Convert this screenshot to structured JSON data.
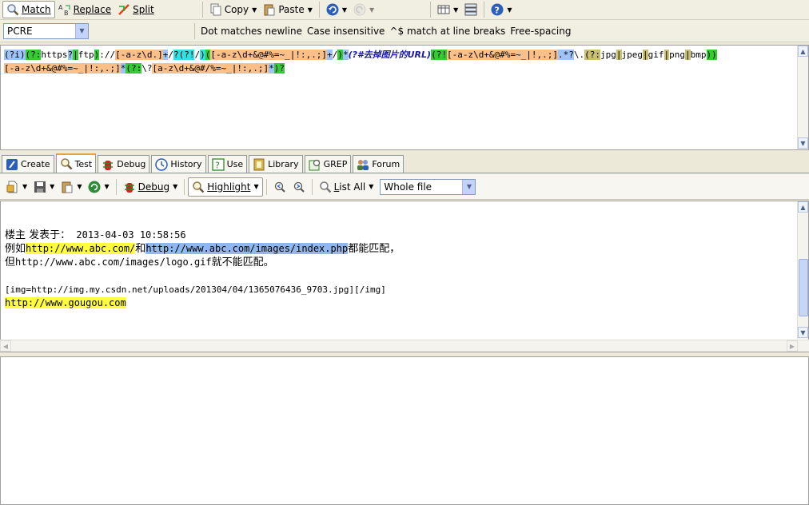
{
  "toolbar1": {
    "match": "Match",
    "replace": "Replace",
    "split": "Split",
    "copy": "Copy",
    "paste": "Paste"
  },
  "toolbar2": {
    "flavor": "PCRE",
    "options": [
      "Dot matches newline",
      "Case insensitive",
      "^$ match at line breaks",
      "Free-spacing"
    ]
  },
  "regex": {
    "tokens": [
      {
        "t": "(?i)",
        "c": "#9ec3f7"
      },
      {
        "t": "(?:",
        "c": "#33cc33"
      },
      {
        "t": "https",
        "c": ""
      },
      {
        "t": "?",
        "c": "#9ec3f7"
      },
      {
        "t": "|",
        "c": "#33cc33"
      },
      {
        "t": "ftp",
        "c": ""
      },
      {
        "t": ")",
        "c": "#33cc33"
      },
      {
        "t": "://",
        "c": ""
      },
      {
        "t": "[-a-z\\d.]",
        "c": "#fbc08a"
      },
      {
        "t": "+",
        "c": "#9ec3f7"
      },
      {
        "t": "/",
        "c": ""
      },
      {
        "t": "?(?!",
        "c": "#33e0e0"
      },
      {
        "t": "/",
        "c": ""
      },
      {
        "t": ")",
        "c": "#33e0e0"
      },
      {
        "t": "(",
        "c": "#33cc33"
      },
      {
        "t": "[-a-z\\d+&@#%=~_|!:,.;]",
        "c": "#fbc08a"
      },
      {
        "t": "+",
        "c": "#9ec3f7"
      },
      {
        "t": "/",
        "c": ""
      },
      {
        "t": ")",
        "c": "#33cc33"
      },
      {
        "t": "*",
        "c": "#9ec3f7"
      },
      {
        "t": "(?#去掉图片的URL)",
        "c": "cmt"
      },
      {
        "t": "(?!",
        "c": "#33cc33"
      },
      {
        "t": "[-a-z\\d+&@#%=~_|!,.;]",
        "c": "#fbc08a"
      },
      {
        "t": ".*?",
        "c": "#9ec3f7"
      },
      {
        "t": "\\.",
        "c": ""
      },
      {
        "t": "(?:",
        "c": "#c8c070"
      },
      {
        "t": "jpg",
        "c": ""
      },
      {
        "t": "|",
        "c": "#c8c070"
      },
      {
        "t": "jpeg",
        "c": ""
      },
      {
        "t": "|",
        "c": "#c8c070"
      },
      {
        "t": "gif",
        "c": ""
      },
      {
        "t": "|",
        "c": "#c8c070"
      },
      {
        "t": "png",
        "c": ""
      },
      {
        "t": "|",
        "c": "#c8c070"
      },
      {
        "t": "bmp",
        "c": ""
      },
      {
        "t": "))",
        "c": "#33cc33"
      },
      {
        "t": "[-a-z\\d+&@#%=~_|!:,.;]",
        "c": "#fbc08a"
      },
      {
        "t": "*",
        "c": "#9ec3f7"
      },
      {
        "t": "(?:",
        "c": "#33cc33"
      },
      {
        "t": "\\?",
        "c": ""
      },
      {
        "t": "[a-z\\d+&@#/%=~_|!:,.;]",
        "c": "#fbc08a"
      },
      {
        "t": "*",
        "c": "#9ec3f7"
      },
      {
        "t": ")?",
        "c": "#33cc33"
      }
    ]
  },
  "tabs": [
    "Create",
    "Test",
    "Debug",
    "History",
    "Use",
    "Library",
    "GREP",
    "Forum"
  ],
  "test_toolbar": {
    "debug": "Debug",
    "highlight": "Highlight",
    "list_all": "List All",
    "scope": "Whole file"
  },
  "subject": {
    "line1": "楼主 发表于：",
    "line1_date": " 2013-04-03 10:58:56",
    "line2_a": "例如",
    "line2_m1": "http://www.abc.com/",
    "line2_b": "和",
    "line2_m2": "http://www.abc.com/images/index.php",
    "line2_c": "都能匹配，",
    "line3_a": "但",
    "line3_b": "http://www.abc.com/images/logo.gif",
    "line3_c": "就不能匹配。",
    "line5": "[img=http://img.my.csdn.net/uploads/201304/04/1365076436_9703.jpg][/img]",
    "line6_m": "http://www.gougou.com"
  }
}
